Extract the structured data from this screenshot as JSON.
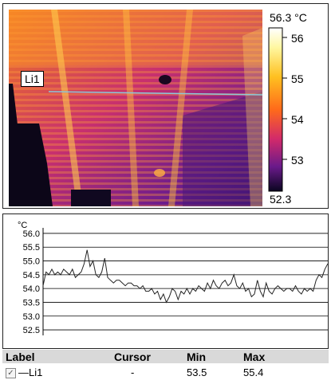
{
  "thermal": {
    "scale_max": "56.3 °C",
    "scale_min": "52.3",
    "scale_ticks": [
      "56",
      "55",
      "54",
      "53"
    ],
    "line_label": "Li1",
    "line_color": "#8cc8d8"
  },
  "graph": {
    "unit": "°C",
    "y_ticks": [
      "56.0",
      "55.5",
      "55.0",
      "54.5",
      "54.0",
      "53.5",
      "53.0",
      "52.5"
    ]
  },
  "chart_data": {
    "type": "line",
    "title": "",
    "xlabel": "",
    "ylabel": "°C",
    "ylim": [
      52.3,
      56.2
    ],
    "grid": true,
    "series": [
      {
        "values": [
          54.1,
          54.6,
          54.5,
          54.7,
          54.5,
          54.6,
          54.5,
          54.7,
          54.6,
          54.5,
          54.7,
          54.4,
          54.5,
          54.6,
          54.9,
          55.4,
          54.8,
          55.0,
          54.5,
          54.4,
          54.6,
          55.1,
          54.4,
          54.3,
          54.2,
          54.3,
          54.3,
          54.2,
          54.1,
          54.2,
          54.2,
          54.1,
          54.1,
          54.0,
          54.1,
          53.9,
          53.9,
          54.0,
          53.8,
          53.9,
          53.6,
          53.8,
          53.5,
          53.7,
          54.0,
          53.9,
          53.6,
          53.9,
          53.8,
          54.0,
          53.8,
          54.0,
          53.9,
          54.1,
          54.0,
          53.9,
          54.2,
          54.0,
          54.3,
          54.1,
          54.0,
          54.2,
          54.3,
          54.1,
          54.2,
          54.5,
          54.1,
          54.0,
          54.2,
          53.9,
          54.0,
          53.7,
          53.8,
          54.3,
          53.9,
          53.7,
          54.2,
          53.9,
          53.8,
          54.0,
          54.1,
          54.0,
          53.9,
          54.0,
          54.0,
          53.9,
          54.1,
          53.9,
          53.8,
          54.0,
          53.9,
          54.0,
          53.9,
          54.3,
          54.5,
          54.4,
          54.7,
          54.9
        ]
      }
    ]
  },
  "table": {
    "headers": {
      "label": "Label",
      "cursor": "Cursor",
      "min": "Min",
      "max": "Max"
    },
    "rows": [
      {
        "checkbox": "✓",
        "label": "—Li1",
        "cursor": "-",
        "min": "53.5",
        "max": "55.4"
      }
    ]
  }
}
